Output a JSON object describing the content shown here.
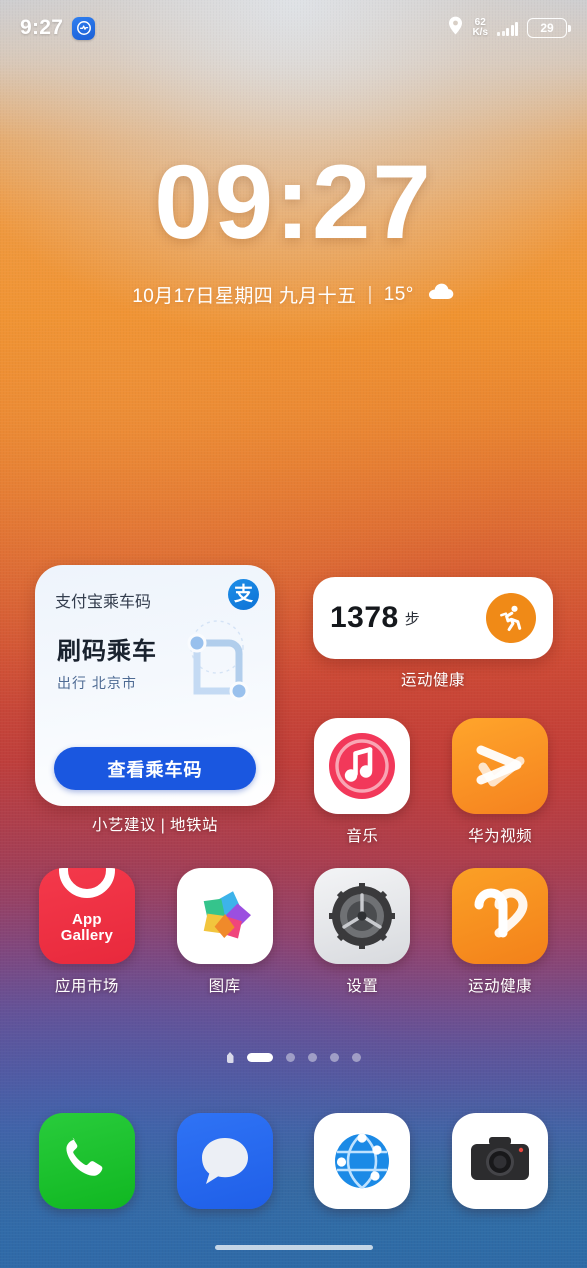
{
  "status_bar": {
    "time": "9:27",
    "app_icon": "health-app-icon",
    "location_icon": "location-pin-icon",
    "net_speed_value": "62",
    "net_speed_unit": "K/s",
    "signal_icon": "signal-bars-icon",
    "battery_level": "29"
  },
  "clock_widget": {
    "time": "09:27",
    "date": "10月17日星期四 九月十五",
    "separator": "|",
    "temperature": "15°",
    "weather_icon": "cloud-icon"
  },
  "transit_widget": {
    "title": "支付宝乘车码",
    "brand_logo": "支",
    "headline": "刷码乘车",
    "subtitle": "出行 北京市",
    "button_label": "查看乘车码",
    "graphic": "subway-route-icon",
    "label": "小艺建议 | 地铁站",
    "accent_color": "#1a57e0"
  },
  "steps_widget": {
    "count": "1378",
    "unit": "步",
    "icon": "running-person-icon",
    "icon_color": "#f08a17",
    "label": "运动健康"
  },
  "app_grid": [
    {
      "name": "音乐",
      "icon": "music-note-icon",
      "icon_class": "ic-music"
    },
    {
      "name": "华为视频",
      "icon": "play-arrow-icon",
      "icon_class": "ic-hwvideo"
    },
    {
      "name": "应用市场",
      "icon": "app-gallery-icon",
      "icon_class": "ic-appgallery",
      "icon_text": "App\nGallery"
    },
    {
      "name": "图库",
      "icon": "gallery-flower-icon",
      "icon_class": "ic-gallery"
    },
    {
      "name": "设置",
      "icon": "gear-icon",
      "icon_class": "ic-settings"
    },
    {
      "name": "运动健康",
      "icon": "heart-health-icon",
      "icon_class": "ic-health"
    }
  ],
  "app_labels": {
    "music": "音乐",
    "hwvideo": "华为视频",
    "appgallery": "应用市场",
    "appgallery_line1": "App",
    "appgallery_line2": "Gallery",
    "gallery": "图库",
    "settings": "设置",
    "health": "运动健康"
  },
  "page_indicator": {
    "total_pages": 5,
    "active_page": 1,
    "home_marker": "home-page-icon"
  },
  "dock": [
    {
      "name": "phone",
      "icon": "phone-icon"
    },
    {
      "name": "messages",
      "icon": "message-bubble-icon"
    },
    {
      "name": "browser",
      "icon": "globe-icon"
    },
    {
      "name": "camera",
      "icon": "camera-icon"
    }
  ],
  "home_indicator": "home-gesture-bar"
}
